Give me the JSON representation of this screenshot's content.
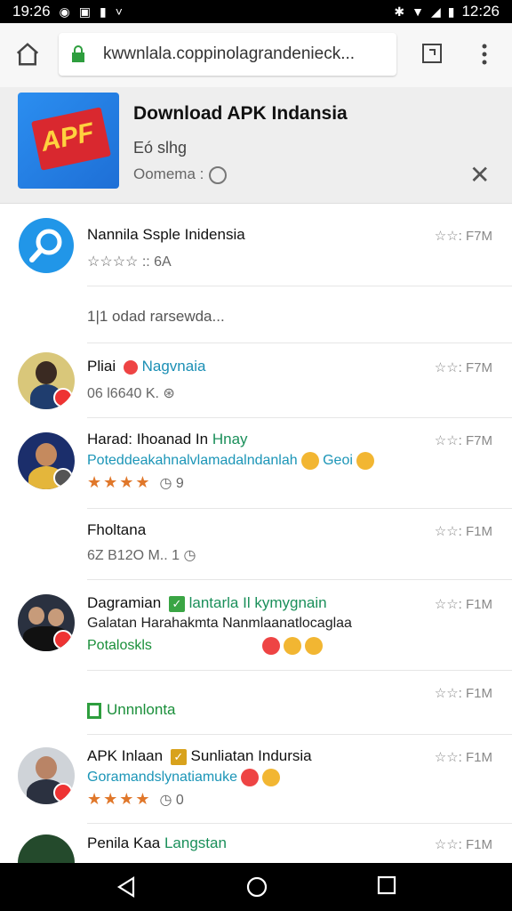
{
  "status": {
    "time_left": "19:26",
    "time_right": "12:26"
  },
  "browser": {
    "url": "kwwnlala.coppinolagrandenieck..."
  },
  "banner": {
    "logo_text": "APF",
    "title": "Download APK Indansia",
    "subtitle": "Eó slhg",
    "meta": "Oomema :"
  },
  "items": [
    {
      "name": "Nannila Ssple Inidensia",
      "line2": "☆☆☆☆ :: 6A",
      "time": "☆☆: F7M"
    },
    {
      "name": "1|1 odad rarsewda..."
    },
    {
      "name": "Pliai",
      "tag": "Nagvnaia",
      "line2": "06 l6640 K.",
      "time": "☆☆: F7M"
    },
    {
      "name": "Harad: Ihoanad In",
      "tag": "Hnay",
      "line2": "Poteddeakahnalvlamadalndanlah",
      "line3_tail": "Geoi",
      "stars": "★★★★",
      "count": "9",
      "time": "☆☆: F7M"
    },
    {
      "name": "Fholtana",
      "line2": "6Z B12O M.. 1",
      "time": "☆☆: F1M"
    },
    {
      "name": "Dagramian",
      "tag": "lantarla Il kymygnain",
      "line2": "Galatan Harahakmta Nanmlaanatlocaglaa",
      "line3": "Potaloskls",
      "time": "☆☆: F1M"
    },
    {
      "name": "Unnnlonta",
      "time": "☆☆: F1M"
    },
    {
      "name": "APK Inlaan",
      "tag": "Sunliatan Indursia",
      "line2": "Goramandslynatiamuke",
      "stars": "★★★★",
      "count": "0",
      "time": "☆☆: F1M"
    },
    {
      "name": "Penila Kaa",
      "tag": "Langstan",
      "time": "☆☆: F1M"
    }
  ]
}
